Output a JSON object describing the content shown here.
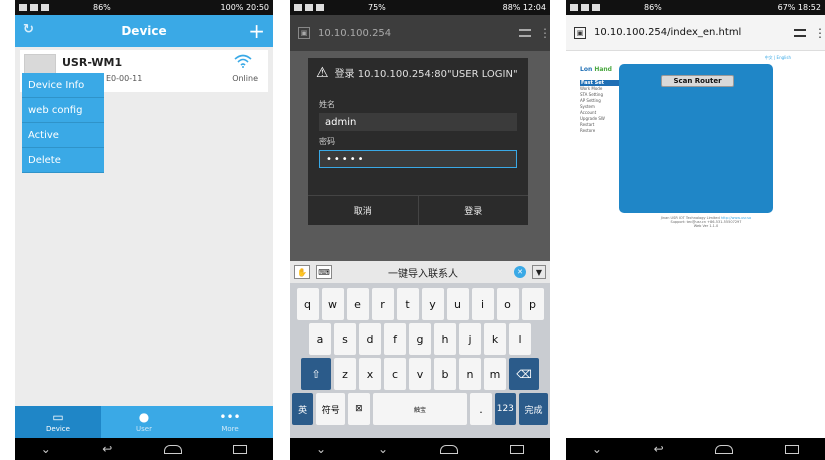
{
  "phone1": {
    "status": {
      "battery": "86%",
      "right": "100% 20:50"
    },
    "appbar": {
      "title": "Device",
      "refresh_icon": "↻",
      "add_icon": "+"
    },
    "device": {
      "name": "USR-WM1",
      "mac": "E0-00-11",
      "status": "Online"
    },
    "menu": [
      {
        "label": "Device Info"
      },
      {
        "label": "web config"
      },
      {
        "label": "Active"
      },
      {
        "label": "Delete"
      }
    ],
    "tabs": [
      {
        "label": "Device",
        "icon": "▭"
      },
      {
        "label": "User",
        "icon": "●"
      },
      {
        "label": "More",
        "icon": "•••"
      }
    ]
  },
  "phone2": {
    "status": {
      "battery": "75%",
      "right": "88% 12:04"
    },
    "url": "10.10.100.254",
    "dialog": {
      "title": "登录 10.10.100.254:80\"USER LOGIN\"",
      "user_label": "姓名",
      "user_value": "admin",
      "pass_label": "密码",
      "pass_value": "•••••",
      "cancel": "取消",
      "login": "登录"
    },
    "keyboard": {
      "top_label": "一键导入联系人",
      "row1": [
        "q",
        "w",
        "e",
        "r",
        "t",
        "y",
        "u",
        "i",
        "o",
        "p"
      ],
      "row2": [
        "a",
        "s",
        "d",
        "f",
        "g",
        "h",
        "j",
        "k",
        "l"
      ],
      "row3": [
        "z",
        "x",
        "c",
        "v",
        "b",
        "n",
        "m"
      ],
      "shift": "⇧",
      "backspace": "⌫",
      "lang": "英",
      "symbols": "符号",
      "space": "触宝",
      "dot": ".",
      "num": "123",
      "done": "完成"
    }
  },
  "phone3": {
    "status": {
      "battery": "86%",
      "right": "67% 18:52"
    },
    "url": "10.10.100.254/index_en.html",
    "lang_links": "中文 | English",
    "logo": {
      "part1": "Lon",
      "part2": "Hand"
    },
    "sidebar": [
      "Fast Set",
      "Work Mode",
      "STA Setting",
      "AP Setting",
      "System",
      "Account",
      "Upgrade SW",
      "Restart",
      "Restore"
    ],
    "scan_button": "Scan Router",
    "footer": {
      "line1": "Jinan USR IOT Technology Limited",
      "link": "http://www.usr.so",
      "line2": "Support: tec@usr.cn +86-531-55507297",
      "line3": "Web Ver 1.1.0"
    }
  }
}
